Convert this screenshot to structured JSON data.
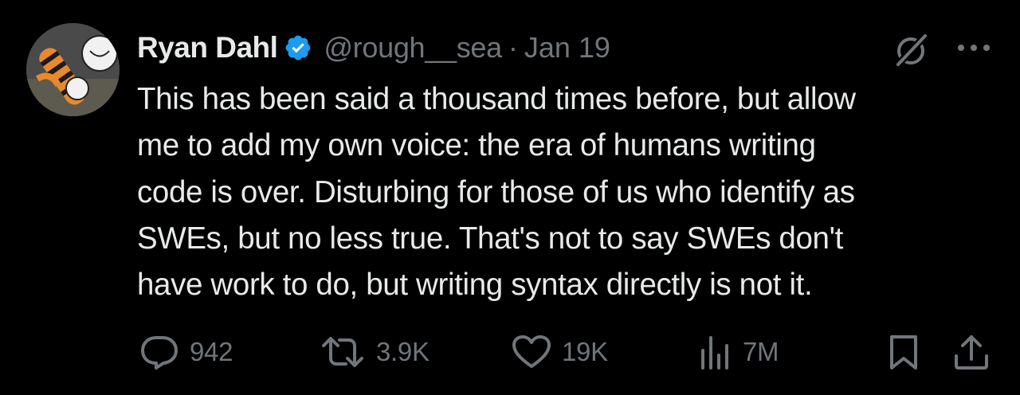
{
  "tweet": {
    "author_name": "Ryan Dahl",
    "verified": true,
    "handle": "@rough__sea",
    "separator": "·",
    "date": "Jan 19",
    "text_lines": [
      "This has been said a thousand times before, but allow",
      "me to add my own voice: the era of humans writing",
      "code is over. Disturbing for those of us who identify as",
      "SWEs, but no less true. That's not to say SWEs don't",
      "have work to do, but writing syntax directly is not it."
    ]
  },
  "actions": {
    "replies": "942",
    "reposts": "3.9K",
    "likes": "19K",
    "views": "7M"
  },
  "icons": {
    "avatar": "avatar-illustration",
    "verified": "verified-badge-icon",
    "grok": "grok-icon",
    "more": "more-icon",
    "reply": "reply-icon",
    "repost": "repost-icon",
    "like": "like-icon",
    "views": "views-icon",
    "bookmark": "bookmark-icon",
    "share": "share-icon"
  },
  "colors": {
    "background": "#000000",
    "primary_text": "#e7e9ea",
    "secondary_text": "#71767b",
    "verified_blue": "#1d9bf0"
  }
}
